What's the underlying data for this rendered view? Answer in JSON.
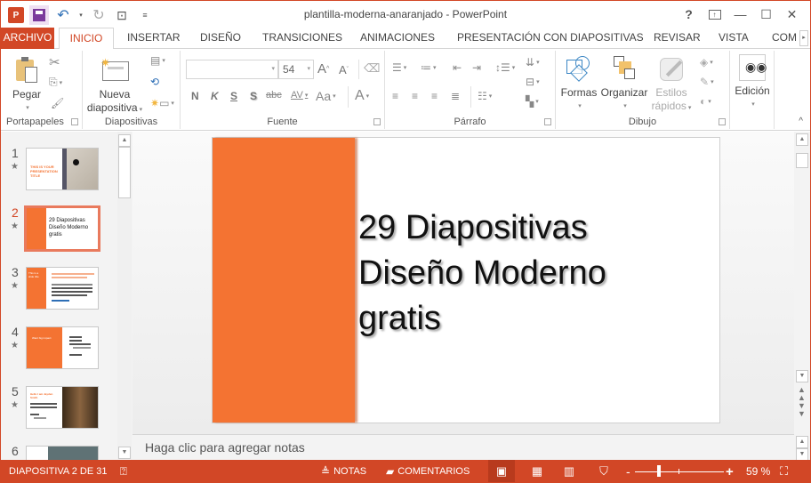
{
  "app": {
    "window_title": "plantilla-moderna-anaranjado - PowerPoint"
  },
  "quick_access": {
    "logo": "P",
    "items": [
      "save-icon",
      "undo-icon",
      "redo-icon",
      "start-from-beginning-icon",
      "customize-icon"
    ]
  },
  "window_controls": {
    "help": "?",
    "ribbon_display": "ribbon-display-icon",
    "minimize": "—",
    "maximize": "☐",
    "close": "✕"
  },
  "tabs": [
    {
      "label": "ARCHIVO"
    },
    {
      "label": "INICIO"
    },
    {
      "label": "INSERTAR"
    },
    {
      "label": "DISEÑO"
    },
    {
      "label": "TRANSICIONES"
    },
    {
      "label": "ANIMACIONES"
    },
    {
      "label": "PRESENTACIÓN CON DIAPOSITIVAS"
    },
    {
      "label": "REVISAR"
    },
    {
      "label": "VISTA"
    },
    {
      "label": "COM"
    }
  ],
  "ribbon": {
    "portapapeles": {
      "label": "Portapapeles",
      "paste": "Pegar"
    },
    "diapositivas": {
      "label": "Diapositivas",
      "new_slide_line1": "Nueva",
      "new_slide_line2": "diapositiva"
    },
    "fuente": {
      "label": "Fuente",
      "font_name": "",
      "font_size": "54",
      "grow": "A",
      "shrink": "A",
      "bold": "N",
      "italic": "K",
      "underline": "S",
      "shadow": "S",
      "strike": "abc",
      "spacing": "AV",
      "case": "Aa",
      "color": "A"
    },
    "parrafo": {
      "label": "Párrafo"
    },
    "dibujo": {
      "label": "Dibujo",
      "shapes": "Formas",
      "arrange": "Organizar",
      "quick_styles_line1": "Estilos",
      "quick_styles_line2": "rápidos"
    },
    "edicion": {
      "label": "Edición"
    }
  },
  "thumbnails": [
    {
      "number": "1",
      "title": "THIS IS YOUR PRESENTATION TITLE"
    },
    {
      "number": "2",
      "title": "29 Diapositivas Diseño Moderno gratis",
      "selected": true
    },
    {
      "number": "3",
      "title": "This is a slide title"
    },
    {
      "number": "4",
      "title": "Want big impact"
    },
    {
      "number": "5",
      "title": "Hello I am Jayden Smith"
    },
    {
      "number": "6",
      "title": ""
    }
  ],
  "slide": {
    "title_lines": [
      "29 Diapositivas",
      "Diseño Moderno",
      "gratis"
    ],
    "accent_color": "#f47332"
  },
  "notes": {
    "placeholder": "Haga clic para agregar notas"
  },
  "statusbar": {
    "slide_info": "DIAPOSITIVA 2 DE 31",
    "notes": "NOTAS",
    "comments": "COMENTARIOS",
    "zoom": "59 %",
    "zoom_fraction": 0.59
  },
  "colors": {
    "brand": "#d24726",
    "accent": "#f47332"
  }
}
